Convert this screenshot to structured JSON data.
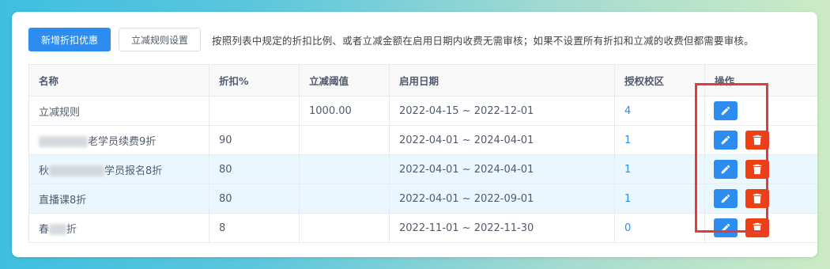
{
  "toolbar": {
    "add_label": "新增折扣优惠",
    "rule_label": "立减规则设置",
    "hint": "按照列表中规定的折扣比例、或者立减金额在启用日期内收费无需审核；如果不设置所有折扣和立减的收费但都需要审核。"
  },
  "table": {
    "headers": {
      "name": "名称",
      "discount": "折扣%",
      "threshold": "立减阈值",
      "date": "启用日期",
      "campus": "授权校区",
      "ops": "操作"
    },
    "rows": [
      {
        "name": "立减规则",
        "discount": "",
        "threshold": "1000.00",
        "date": "2022-04-15 ~ 2022-12-01",
        "campus": "4"
      },
      {
        "name_visible": "老学员续费9折",
        "discount": "90",
        "threshold": "",
        "date": "2022-04-01 ~ 2024-04-01",
        "campus": "1"
      },
      {
        "name_prefix": "秋",
        "name_visible": "学员报名8折",
        "discount": "80",
        "threshold": "",
        "date": "2022-04-01 ~ 2024-04-01",
        "campus": "1"
      },
      {
        "name": "直播课8折",
        "discount": "80",
        "threshold": "",
        "date": "2022-04-01 ~ 2022-09-01",
        "campus": "1"
      },
      {
        "name_prefix": "春",
        "name_visible": "折",
        "discount": "8",
        "threshold": "",
        "date": "2022-11-01 ~ 2022-11-30",
        "campus": "0"
      }
    ]
  },
  "icons": {
    "edit": "pencil-icon",
    "delete": "trash-icon"
  },
  "colors": {
    "primary": "#2d8cf0",
    "danger": "#ed4014",
    "highlight": "#e03c3c",
    "row_stripe": "#ebf7ff"
  }
}
